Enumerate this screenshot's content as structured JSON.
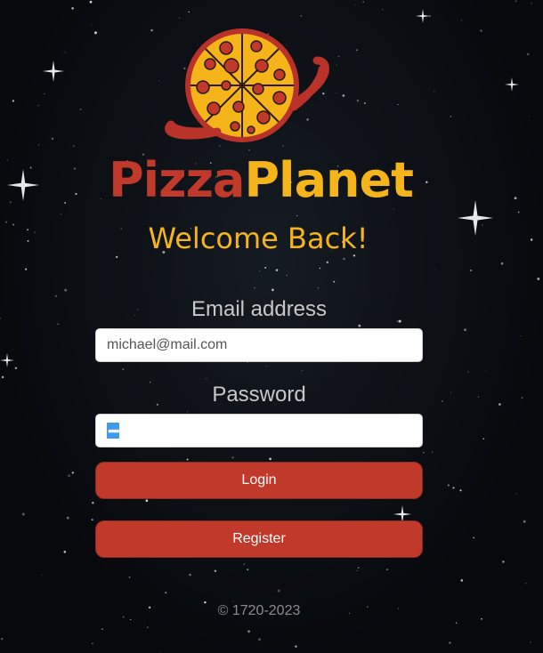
{
  "brand": {
    "name_part1": "Pizza",
    "name_part2": "Planet",
    "welcome": "Welcome Back!"
  },
  "form": {
    "email_label": "Email address",
    "email_value": "michael@mail.com",
    "password_label": "Password",
    "password_value": "••••"
  },
  "buttons": {
    "login_label": "Login",
    "register_label": "Register"
  },
  "footer": {
    "copyright": "© 1720-2023"
  },
  "icons": {
    "logo": "pizza-planet-logo-icon"
  },
  "colors": {
    "brand_red": "#c0392b",
    "brand_yellow": "#f4b41a",
    "background": "#07090d",
    "button": "#c0392b",
    "autofill_highlight": "#3d9be9"
  }
}
